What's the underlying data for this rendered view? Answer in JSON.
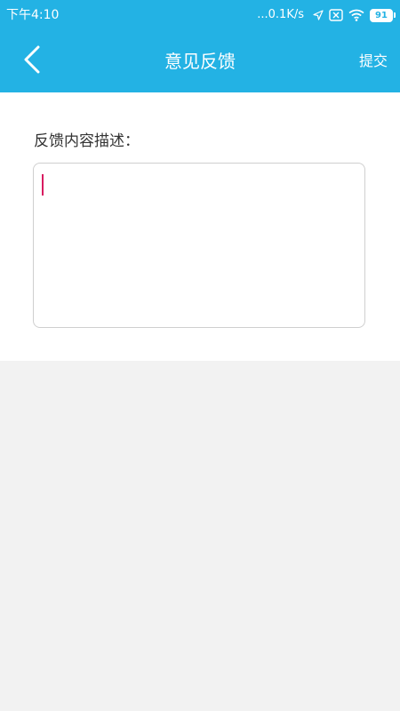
{
  "status_bar": {
    "time": "下午4:10",
    "net_speed": "...0.1K/s",
    "battery": "91",
    "icons": [
      "location-arrow-icon",
      "sim-off-icon",
      "wifi-icon",
      "battery-icon"
    ]
  },
  "nav": {
    "title": "意见反馈",
    "back_icon": "chevron-left-icon",
    "submit_label": "提交"
  },
  "form": {
    "label": "反馈内容描述：",
    "feedback_value": "",
    "placeholder": ""
  },
  "colors": {
    "accent": "#23b2e4",
    "caret": "#d81b60",
    "background": "#f2f2f2"
  }
}
